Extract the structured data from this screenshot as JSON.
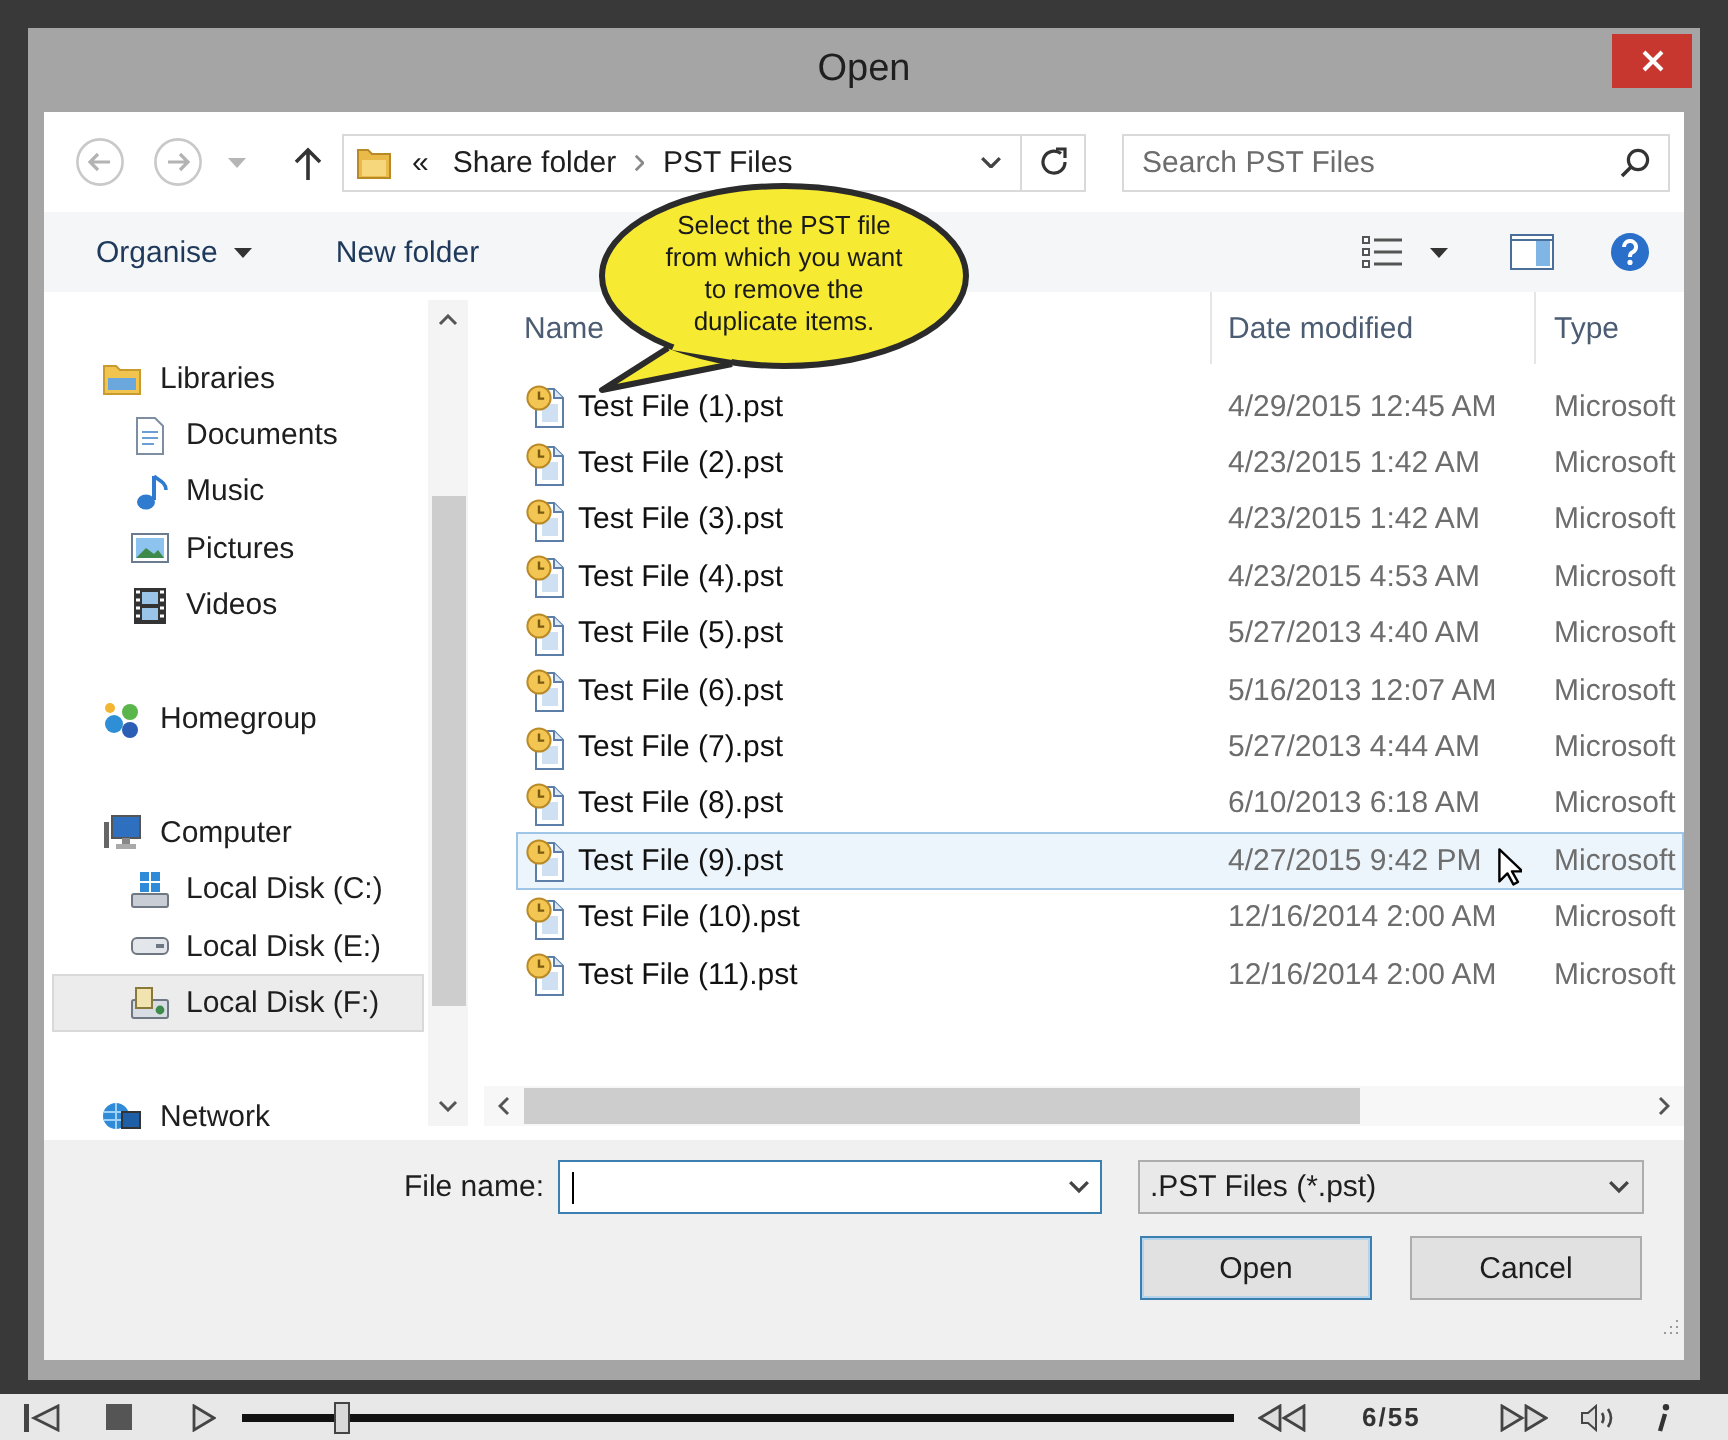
{
  "window": {
    "title": "Open"
  },
  "address_bar": {
    "overflow": "«",
    "breadcrumbs": [
      "Share folder",
      "PST Files"
    ]
  },
  "search": {
    "placeholder": "Search PST Files"
  },
  "toolbar": {
    "buttons": [
      {
        "label": "Organise",
        "has_menu": true
      },
      {
        "label": "New folder",
        "has_menu": false
      }
    ]
  },
  "callout": {
    "text": "Select the PST file from which you want to remove the duplicate items."
  },
  "sidebar": {
    "items": [
      {
        "label": "Libraries",
        "kind": "libraries",
        "selected": false,
        "children": [
          {
            "label": "Documents",
            "kind": "documents",
            "selected": false
          },
          {
            "label": "Music",
            "kind": "music",
            "selected": false
          },
          {
            "label": "Pictures",
            "kind": "pictures",
            "selected": false
          },
          {
            "label": "Videos",
            "kind": "videos",
            "selected": false
          }
        ]
      },
      {
        "label": "Homegroup",
        "kind": "homegroup",
        "selected": false
      },
      {
        "label": "Computer",
        "kind": "computer",
        "selected": false,
        "children": [
          {
            "label": "Local Disk (C:)",
            "kind": "disk-system",
            "selected": false
          },
          {
            "label": "Local Disk (E:)",
            "kind": "disk",
            "selected": false
          },
          {
            "label": "Local Disk (F:)",
            "kind": "disk-network",
            "selected": true
          }
        ]
      },
      {
        "label": "Network",
        "kind": "network",
        "selected": false
      }
    ]
  },
  "table": {
    "columns": [
      "Name",
      "Date modified",
      "Type"
    ],
    "rows": [
      {
        "name": "Test File (1).pst",
        "date_modified": "4/29/2015 12:45 AM",
        "type": "Microsoft",
        "selected": false
      },
      {
        "name": "Test File (2).pst",
        "date_modified": "4/23/2015 1:42 AM",
        "type": "Microsoft",
        "selected": false
      },
      {
        "name": "Test File (3).pst",
        "date_modified": "4/23/2015 1:42 AM",
        "type": "Microsoft",
        "selected": false
      },
      {
        "name": "Test File (4).pst",
        "date_modified": "4/23/2015 4:53 AM",
        "type": "Microsoft",
        "selected": false
      },
      {
        "name": "Test File (5).pst",
        "date_modified": "5/27/2013 4:40 AM",
        "type": "Microsoft",
        "selected": false
      },
      {
        "name": "Test File (6).pst",
        "date_modified": "5/16/2013 12:07 AM",
        "type": "Microsoft",
        "selected": false
      },
      {
        "name": "Test File (7).pst",
        "date_modified": "5/27/2013 4:44 AM",
        "type": "Microsoft",
        "selected": false
      },
      {
        "name": "Test File (8).pst",
        "date_modified": "6/10/2013 6:18 AM",
        "type": "Microsoft",
        "selected": false
      },
      {
        "name": "Test File (9).pst",
        "date_modified": "4/27/2015 9:42 PM",
        "type": "Microsoft",
        "selected": true
      },
      {
        "name": "Test File (10).pst",
        "date_modified": "12/16/2014 2:00 AM",
        "type": "Microsoft",
        "selected": false
      },
      {
        "name": "Test File (11).pst",
        "date_modified": "12/16/2014 2:00 AM",
        "type": "Microsoft",
        "selected": false
      }
    ]
  },
  "file_name": {
    "label": "File name:",
    "focused": true
  },
  "file_type": {
    "value": ".PST Files (*.pst)"
  },
  "buttons": [
    {
      "label": "Open",
      "default": true
    },
    {
      "label": "Cancel",
      "default": false
    }
  ],
  "player": {
    "level": 0.1,
    "counter": "6/55"
  }
}
